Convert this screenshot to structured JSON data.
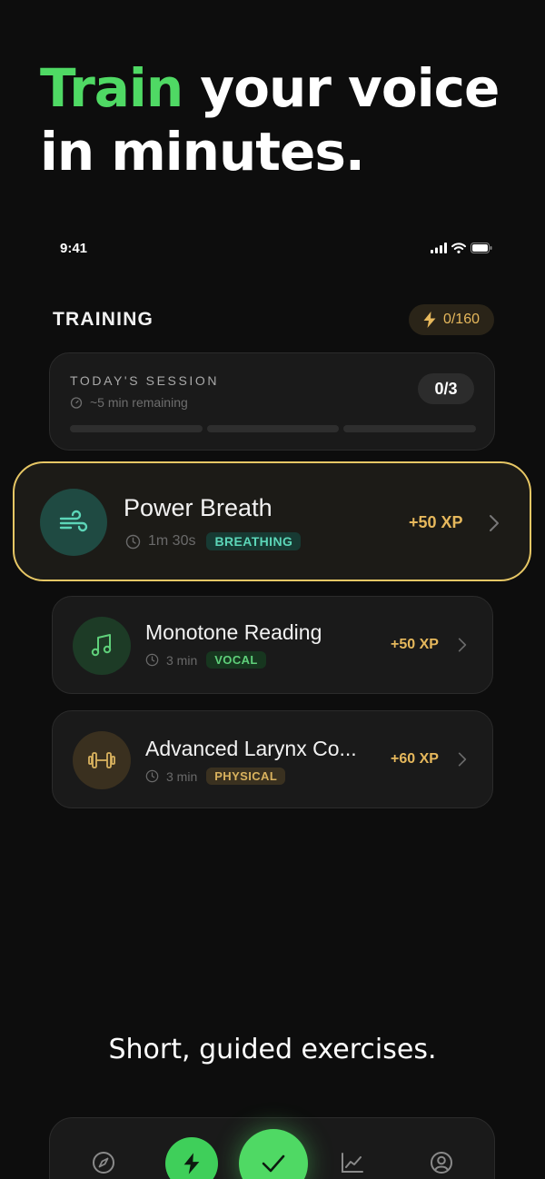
{
  "hero": {
    "headline_accent": "Train",
    "headline_rest_1": " your voice",
    "headline_rest_2": "in minutes."
  },
  "status_bar": {
    "time": "9:41"
  },
  "training": {
    "title": "TRAINING",
    "xp_total": "0/160"
  },
  "session": {
    "label": "TODAY'S SESSION",
    "remaining": "~5 min remaining",
    "count": "0/3",
    "progress_completed": 0,
    "progress_total": 3
  },
  "exercises": [
    {
      "title": "Power Breath",
      "duration": "1m 30s",
      "tag": "BREATHING",
      "xp": "+50 XP",
      "icon": "wind-icon",
      "tag_color": "#5cd6b8",
      "tag_bg": "#173a33",
      "icon_bg": "#1f4a42"
    },
    {
      "title": "Monotone Reading",
      "duration": "3 min",
      "tag": "VOCAL",
      "xp": "+50 XP",
      "icon": "music-note-icon",
      "tag_color": "#5fd07a",
      "tag_bg": "#17361f",
      "icon_bg": "#1d3b26"
    },
    {
      "title": "Advanced Larynx Co...",
      "duration": "3 min",
      "tag": "PHYSICAL",
      "xp": "+60 XP",
      "icon": "dumbbell-icon",
      "tag_color": "#d9b25e",
      "tag_bg": "#3a3120",
      "icon_bg": "#3a301f"
    }
  ],
  "caption": "Short, guided exercises.",
  "tabbar": {
    "items": [
      "compass-icon",
      "lightning-icon",
      "check-icon",
      "chart-icon",
      "profile-icon"
    ],
    "accent": "#4fd964"
  },
  "colors": {
    "accent_green": "#4fd964",
    "highlight_border": "#e7c765",
    "xp_gold": "#e6b85c",
    "background": "#0d0d0d"
  }
}
